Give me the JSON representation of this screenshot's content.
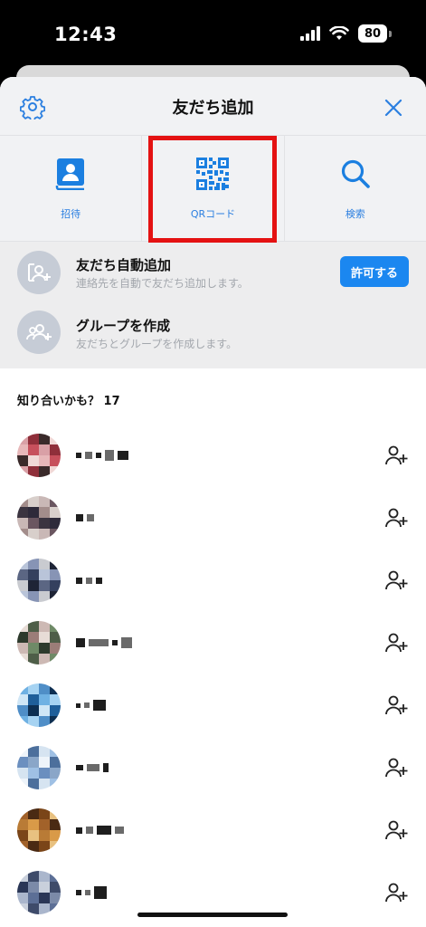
{
  "status_bar": {
    "time": "12:43",
    "battery": "80"
  },
  "header": {
    "title": "友だち追加"
  },
  "tabs": [
    {
      "label": "招待",
      "icon": "contact-book-icon"
    },
    {
      "label": "QRコード",
      "icon": "qr-code-icon"
    },
    {
      "label": "検索",
      "icon": "search-icon"
    }
  ],
  "actions": {
    "auto_add": {
      "title": "友だち自動追加",
      "subtitle": "連絡先を自動で友だち追加します。",
      "button": "許可する"
    },
    "create_group": {
      "title": "グループを作成",
      "subtitle": "友だちとグループを作成します。"
    }
  },
  "suggestions": {
    "header": "知り合いかも？ 17"
  },
  "colors": {
    "accent": "#1b87f0",
    "highlight": "#e41212",
    "header_bg": "#f1f2f4"
  }
}
